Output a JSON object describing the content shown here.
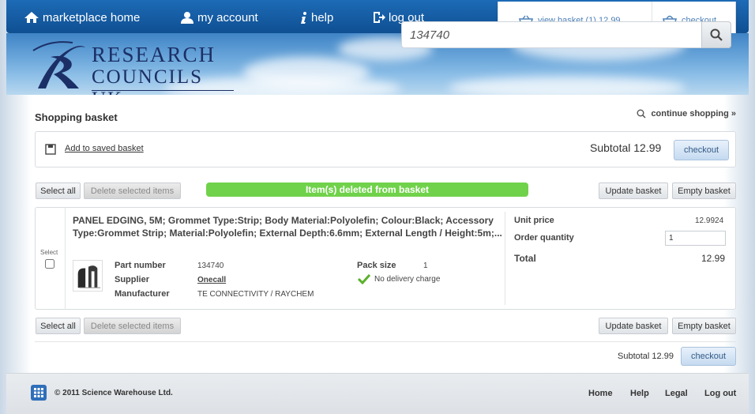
{
  "nav": {
    "home": "marketplace home",
    "account": "my account",
    "help": "help",
    "logout": "log out"
  },
  "basket_bar": {
    "view_basket": "view basket (1) 12.99",
    "checkout": "checkout"
  },
  "logo": {
    "line1": "RESEARCH",
    "line2": "COUNCILS UK"
  },
  "search": {
    "value": "134740"
  },
  "page": {
    "title": "Shopping basket",
    "continue": "continue shopping »"
  },
  "saved": {
    "link": "Add to saved basket",
    "subtotal": "Subtotal 12.99",
    "checkout": "checkout"
  },
  "actions": {
    "select_all": "Select all",
    "delete_selected": "Delete selected items",
    "update": "Update basket",
    "empty": "Empty basket"
  },
  "notice": "Item(s) deleted from basket",
  "item": {
    "select_label": "Select",
    "checked": false,
    "title": "PANEL EDGING, 5M; Grommet Type:Strip; Body Material:Polyolefin; Colour:Black; Accessory Type:Grommet Strip; Material:Polyolefin; External Depth:6.6mm; External Length / Height:5m;...",
    "part_number_label": "Part number",
    "part_number": "134740",
    "supplier_label": "Supplier",
    "supplier": "Onecall",
    "manufacturer_label": "Manufacturer",
    "manufacturer": "TE CONNECTIVITY / RAYCHEM",
    "pack_size_label": "Pack size",
    "pack_size": "1",
    "delivery": "No delivery charge",
    "unit_price_label": "Unit price",
    "unit_price": "12.9924",
    "order_qty_label": "Order quantity",
    "order_qty": "1",
    "total_label": "Total",
    "total": "12.99"
  },
  "bottom": {
    "subtotal": "Subtotal 12.99",
    "checkout": "checkout"
  },
  "footer": {
    "copyright": "© 2011 Science Warehouse Ltd.",
    "links": [
      "Home",
      "Help",
      "Legal",
      "Log out"
    ]
  },
  "colors": {
    "nav_blue": "#1d6bb6",
    "notice_green": "#70d24a",
    "link_blue": "#4f82b8"
  }
}
